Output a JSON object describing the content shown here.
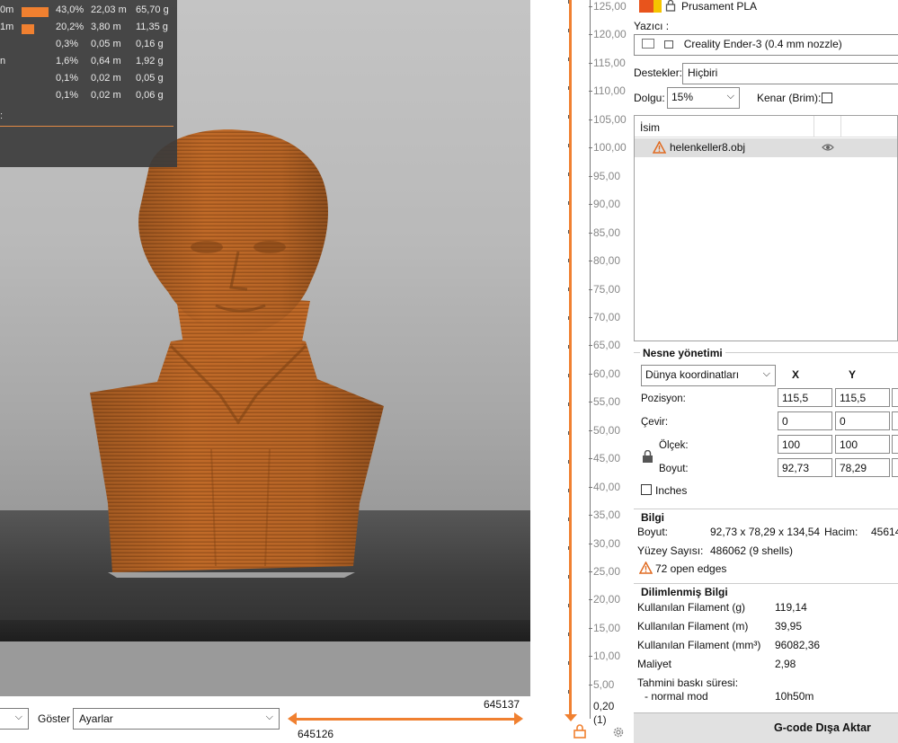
{
  "stats": {
    "rows": [
      {
        "len": "0m",
        "pct": "43,0%",
        "m": "22,03 m",
        "g": "65,70 g",
        "bar": 1.0
      },
      {
        "len": "1m",
        "pct": "20,2%",
        "m": "3,80 m",
        "g": "11,35 g",
        "bar": 0.45
      },
      {
        "len": "",
        "pct": "0,3%",
        "m": "0,05 m",
        "g": "0,16 g",
        "bar": 0
      },
      {
        "len": "n",
        "pct": "1,6%",
        "m": "0,64 m",
        "g": "1,92 g",
        "bar": 0
      },
      {
        "len": "",
        "pct": "0,1%",
        "m": "0,02 m",
        "g": "0,05 g",
        "bar": 0
      },
      {
        "len": "",
        "pct": "0,1%",
        "m": "0,02 m",
        "g": "0,06 g",
        "bar": 0
      }
    ],
    "trailing": ":"
  },
  "bottombar": {
    "show_label": "Göster",
    "show_value": "Ayarlar",
    "layer_top": "645137",
    "layer_bottom": "645126"
  },
  "vslider": {
    "labels": [
      "125,00",
      "120,00",
      "115,00",
      "110,00",
      "105,00",
      "100,00",
      "95,00",
      "90,00",
      "85,00",
      "80,00",
      "75,00",
      "70,00",
      "65,00",
      "60,00",
      "55,00",
      "50,00",
      "45,00",
      "40,00",
      "35,00",
      "30,00",
      "25,00",
      "20,00",
      "15,00",
      "10,00",
      "5,00"
    ],
    "bottom_value": "0,20",
    "bottom_count": "(1)"
  },
  "panel": {
    "filament_name": "Prusament PLA",
    "printer_label": "Yazıcı :",
    "printer_value": "Creality Ender-3 (0.4 mm nozzle)",
    "supports_label": "Destekler:",
    "supports_value": "Hiçbiri",
    "infill_label": "Dolgu:",
    "infill_value": "15%",
    "brim_label": "Kenar (Brim):",
    "list_header": "İsim",
    "object_name": "helenkeller8.obj",
    "manipulation": {
      "title": "Nesne yönetimi",
      "coord_mode": "Dünya koordinatları",
      "col_x": "X",
      "col_y": "Y",
      "position_label": "Pozisyon:",
      "rotate_label": "Çevir:",
      "scale_label": "Ölçek:",
      "size_label": "Boyut:",
      "position_x": "115,5",
      "position_y": "115,5",
      "rotate_x": "0",
      "rotate_y": "0",
      "scale_x": "100",
      "scale_y": "100",
      "size_x": "92,73",
      "size_y": "78,29",
      "inches_label": "Inches"
    },
    "info": {
      "title": "Bilgi",
      "size_label": "Boyut:",
      "size_value": "92,73 x 78,29 x 134,54",
      "volume_label": "Hacim:",
      "volume_value": "45614",
      "facets_label": "Yüzey Sayısı:",
      "facets_value": "486062 (9 shells)",
      "warning": "72 open edges"
    },
    "sliced": {
      "title": "Dilimlenmiş Bilgi",
      "rows": [
        {
          "label": "Kullanılan Filament (g)",
          "value": "119,14"
        },
        {
          "label": "Kullanılan Filament (m)",
          "value": "39,95"
        },
        {
          "label": "Kullanılan Filament (mm³)",
          "value": "96082,36"
        },
        {
          "label": "Maliyet",
          "value": "2,98"
        }
      ],
      "time_label": "Tahmini baskı süresi:",
      "mode_label": "- normal mod",
      "mode_value": "10h50m"
    },
    "export_button": "G-code Dışa Aktar"
  },
  "colors": {
    "accent": "#f08030",
    "model": "#c8702a"
  }
}
